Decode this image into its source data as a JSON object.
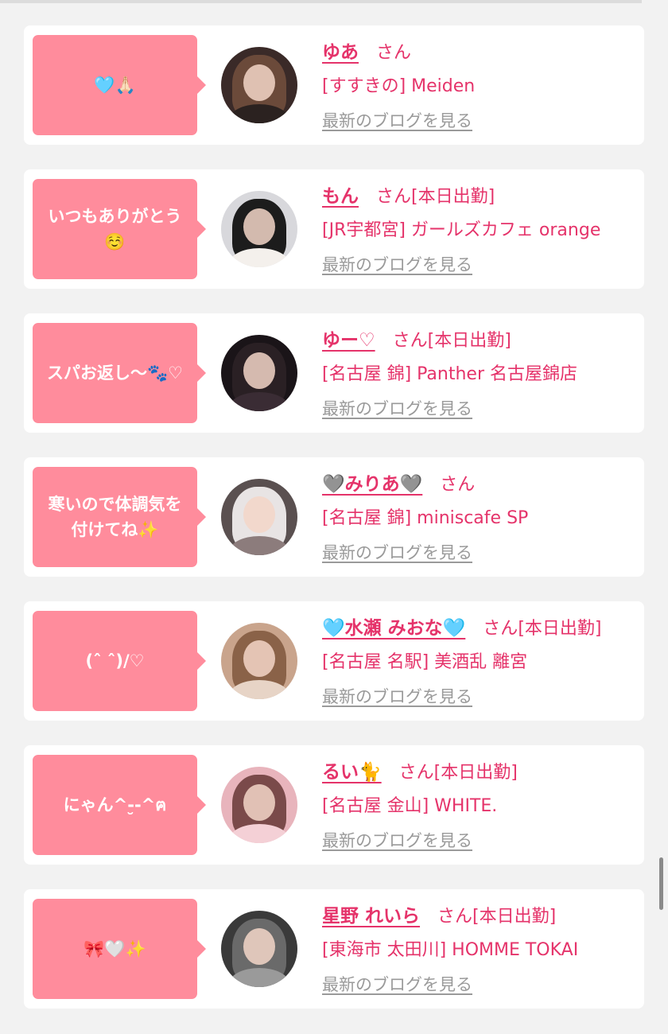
{
  "blog_link_label": "最新のブログを見る",
  "suffix": "さん",
  "colors": {
    "bubble": "#ff8c9c",
    "accent": "#e5336a",
    "link_gray": "#9a9a9a"
  },
  "entries": [
    {
      "message": "🩵🙏🏻",
      "name": "ゆあ",
      "status": "",
      "shop": "[すすきの] Meiden",
      "avatar": {
        "bg": "#3a2a28",
        "hair": "#6b4a3a",
        "shoulder": "#2b2220"
      }
    },
    {
      "message": "いつもありがとう\n☺️",
      "name": "もん",
      "status": "[本日出勤]",
      "shop": "[JR宇都宮] ガールズカフェ orange",
      "avatar": {
        "bg": "#d8d8dc",
        "hair": "#1c1c1c",
        "shoulder": "#f4f0ec"
      }
    },
    {
      "message": "スパお返し〜🐾♡",
      "name": "ゆー♡",
      "status": "[本日出勤]",
      "shop": "[名古屋 錦] Panther 名古屋錦店",
      "avatar": {
        "bg": "#1a1418",
        "hair": "#2a2024",
        "shoulder": "#3a2c34"
      }
    },
    {
      "message": "寒いので体調気を\n付けてね✨",
      "name": "🩶みりあ🩶",
      "status": "",
      "shop": "[名古屋 錦] miniscafe SP",
      "avatar": {
        "bg": "#5a5050",
        "hair": "#e8e4e4",
        "shoulder": "#8c7c7c"
      }
    },
    {
      "message": "(ˆ ˆ)/♡",
      "name": "🩵水瀬 みおな🩵",
      "status": "[本日出勤]",
      "shop": "[名古屋 名駅] 美酒乱 離宮",
      "avatar": {
        "bg": "#c9a48c",
        "hair": "#8a6248",
        "shoulder": "#e7d4c6"
      }
    },
    {
      "message": "にゃん^-̮-^ฅ",
      "name": "るい🐈",
      "status": "[本日出勤]",
      "shop": "[名古屋 金山] WHITE.",
      "avatar": {
        "bg": "#e8b4bc",
        "hair": "#7a4a4a",
        "shoulder": "#f4d0d6"
      }
    },
    {
      "message": "🎀🤍✨",
      "name": "星野 れいら",
      "status": "[本日出勤]",
      "shop": "[東海市 太田川] HOMME TOKAI",
      "avatar": {
        "bg": "#3a3a3a",
        "hair": "#6a6a6a",
        "shoulder": "#9a9a9a"
      }
    }
  ]
}
